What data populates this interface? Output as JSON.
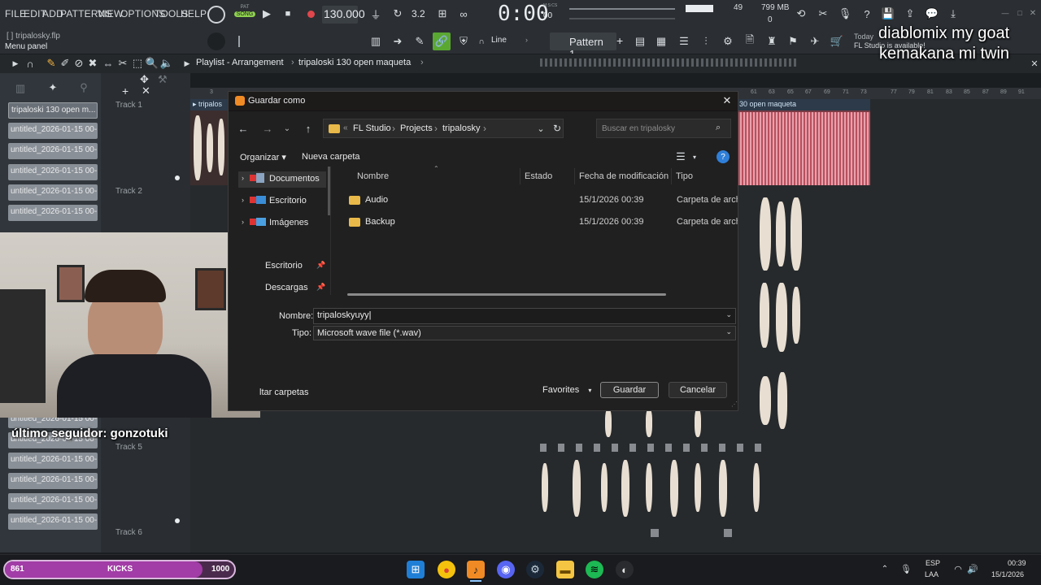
{
  "menu": [
    "FILE",
    "EDIT",
    "ADD",
    "PATTERNS",
    "VIEW",
    "OPTIONS",
    "TOOLS",
    "HELP"
  ],
  "transport": {
    "mode_top": "PAT",
    "mode_bottom": "SONG",
    "tempo": "130.000",
    "time": "0:00",
    "time_small": "00",
    "time_unit": "M:S:CS",
    "steps": "3.2",
    "cpu": "49",
    "memory": "799 MB",
    "voices": "0"
  },
  "project": {
    "file": "tripalosky.flp",
    "hint": "Menu panel",
    "news_today": "Today",
    "news_text": "FL Studio is available!"
  },
  "toolbar2": {
    "snap_mode": "Line",
    "pattern": "Pattern 1"
  },
  "playlist": {
    "title": "Playlist - Arrangement",
    "arrangement": "tripaloski 130 open maqueta",
    "clip_left": "tripalos",
    "clip_right": "30 open maqueta",
    "ruler": [
      "3",
      "61",
      "63",
      "65",
      "67",
      "69",
      "71",
      "73",
      "77",
      "79",
      "81",
      "83",
      "85",
      "87",
      "89",
      "91"
    ],
    "tracks": [
      "Track 1",
      "Track 2",
      "Track 5",
      "Track 6"
    ]
  },
  "browser": {
    "top_item": "tripaloski 130 open m...",
    "items": [
      "untitled_2026-01-15 00-...",
      "untitled_2026-01-15 00-...",
      "untitled_2026-01-15 00-...",
      "untitled_2026-01-15 00-...",
      "untitled_2026-01-15 00-...",
      "untitled_2026-01-15 00-...",
      "untitled_2026-01-15 00-...",
      "untitled_2026-01-15 00-...",
      "untitled_2026-01-15 00-...",
      "untitled_2026-01-15 00-...",
      "untitled_2026-01-15 00-..."
    ]
  },
  "overlay": {
    "line1": "diablomix my goat",
    "line2": "kemakana mi twin",
    "follower": "último seguidor: gonzotuki"
  },
  "dialog": {
    "title": "Guardar como",
    "breadcrumb": [
      "FL Studio",
      "Projects",
      "tripalosky"
    ],
    "search_placeholder": "Buscar en tripalosky",
    "organize": "Organizar",
    "new_folder": "Nueva carpeta",
    "nav": [
      "Documentos",
      "Escritorio",
      "Imágenes",
      "Escritorio",
      "Descargas"
    ],
    "columns": [
      "Nombre",
      "Estado",
      "Fecha de modificación",
      "Tipo"
    ],
    "files": [
      {
        "name": "Audio",
        "date": "15/1/2026 00:39",
        "type": "Carpeta de archivos"
      },
      {
        "name": "Backup",
        "date": "15/1/2026 00:39",
        "type": "Carpeta de archivos"
      }
    ],
    "name_label": "Nombre:",
    "name_value": "tripaloskyuyy",
    "type_label": "Tipo:",
    "type_value": "Microsoft wave file (*.wav)",
    "hide_folders": "ltar carpetas",
    "favorites": "Favorites",
    "save": "Guardar",
    "cancel": "Cancelar"
  },
  "hype_bar": {
    "left": "861",
    "label": "KICKS",
    "right": "1000",
    "progress": 0.86
  },
  "taskbar": {
    "lang_top": "ESP",
    "lang_bottom": "LAA",
    "time": "00:39",
    "date": "15/1/2026"
  },
  "colors": {
    "accent_green": "#5aa832",
    "dialog_bg": "#202020",
    "waveform": "#e8dfd2",
    "clip_red": "#c8616f",
    "hype_bar": "#a23ca6"
  }
}
